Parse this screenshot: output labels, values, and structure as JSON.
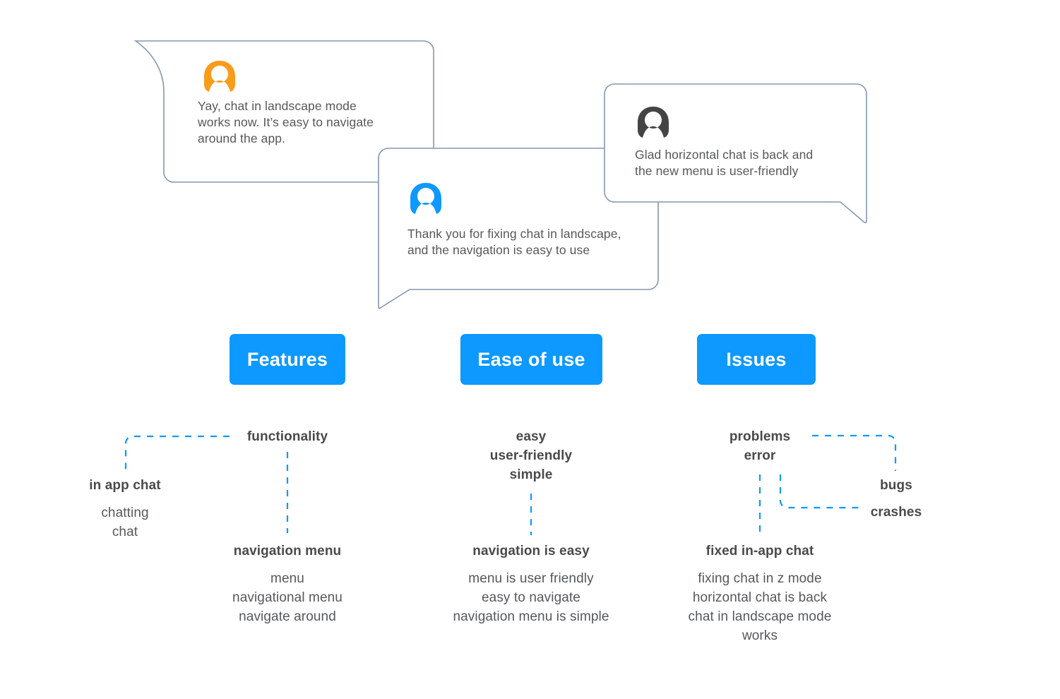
{
  "colors": {
    "accent_blue": "#0d99ff",
    "bubble_border": "#8497ae",
    "text_dark": "#4a4a4a",
    "text_body": "#55585c",
    "avatar_orange": "#f99c1c",
    "avatar_blue": "#0d99ff",
    "avatar_gray": "#444444",
    "background": "#ffffff"
  },
  "bubbles": [
    {
      "id": "bubble-orange",
      "avatar_icon": "person-avatar-icon",
      "avatar_color": "#f99c1c",
      "text": "Yay, chat in landscape mode\nworks now. It’s easy to navigate\naround the app.",
      "tail": "top-left"
    },
    {
      "id": "bubble-blue",
      "avatar_icon": "person-avatar-icon",
      "avatar_color": "#0d99ff",
      "text": "Thank you for fixing chat in landscape,\nand the navigation is easy to use",
      "tail": "bottom-left"
    },
    {
      "id": "bubble-gray",
      "avatar_icon": "person-avatar-icon",
      "avatar_color": "#444444",
      "text": "Glad horizontal chat is back and\nthe new menu is user-friendly",
      "tail": "bottom-right"
    }
  ],
  "categories": [
    {
      "id": "features",
      "label": "Features"
    },
    {
      "id": "ease-of-use",
      "label": "Ease of use"
    },
    {
      "id": "issues",
      "label": "Issues"
    }
  ],
  "keyword_groups": {
    "features": {
      "functionality": {
        "head": "functionality",
        "sub": ""
      },
      "in_app_chat": {
        "head": "in app chat",
        "sub": "chatting\nchat"
      },
      "navigation_menu": {
        "head": "navigation menu",
        "sub": "menu\nnavigational menu\nnavigate around"
      }
    },
    "ease_of_use": {
      "easy_cluster": {
        "head": "easy\nuser-friendly\nsimple",
        "sub": ""
      },
      "navigation_is_easy": {
        "head": "navigation is easy",
        "sub": "menu is user friendly\neasy to navigate\nnavigation menu is simple"
      }
    },
    "issues": {
      "problems_cluster": {
        "head": "problems\nerror",
        "sub": ""
      },
      "bugs": {
        "head": "bugs",
        "sub": ""
      },
      "crashes": {
        "head": "crashes",
        "sub": ""
      },
      "fixed_in_app_chat": {
        "head": "fixed in-app chat",
        "sub": "fixing chat in z mode\nhorizontal chat is back\nchat in landscape mode\nworks"
      }
    }
  }
}
